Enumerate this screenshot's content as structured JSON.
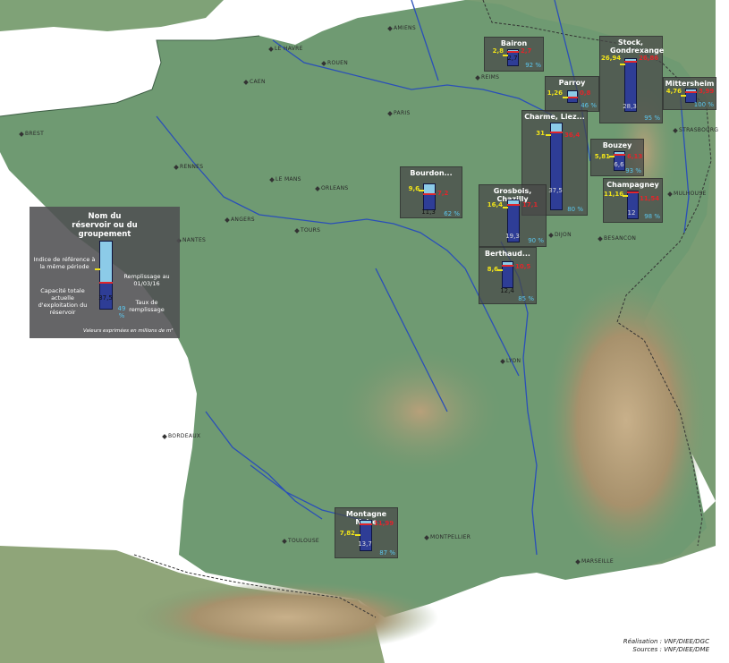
{
  "cities": [
    {
      "id": "amiens",
      "name": "AMIENS"
    },
    {
      "id": "le-havre",
      "name": "LE HAVRE"
    },
    {
      "id": "rouen",
      "name": "ROUEN"
    },
    {
      "id": "caen",
      "name": "CAEN"
    },
    {
      "id": "reims",
      "name": "REIMS"
    },
    {
      "id": "paris",
      "name": "PARIS"
    },
    {
      "id": "brest",
      "name": "BREST"
    },
    {
      "id": "rennes",
      "name": "RENNES"
    },
    {
      "id": "le-mans",
      "name": "LE MANS"
    },
    {
      "id": "orleans",
      "name": "ORLEANS"
    },
    {
      "id": "angers",
      "name": "ANGERS"
    },
    {
      "id": "tours",
      "name": "TOURS"
    },
    {
      "id": "nantes",
      "name": "NANTES"
    },
    {
      "id": "dijon",
      "name": "DIJON"
    },
    {
      "id": "besancon",
      "name": "BESANCON"
    },
    {
      "id": "mulhouse",
      "name": "MULHOUSE"
    },
    {
      "id": "strasbourg",
      "name": "STRASBOURG"
    },
    {
      "id": "lyon",
      "name": "LYON"
    },
    {
      "id": "bordeaux",
      "name": "BORDEAUX"
    },
    {
      "id": "toulouse",
      "name": "TOULOUSE"
    },
    {
      "id": "montpellier",
      "name": "MONTPELLIER"
    },
    {
      "id": "marseille",
      "name": "MARSEILLE"
    }
  ],
  "reservoirs": [
    {
      "id": "bairon",
      "name": "Bairon",
      "reference": "2,8",
      "filling": "2,7",
      "capacity": "2,7",
      "rate": "92 %",
      "ref_level": 0.3,
      "fill_level": 0.1
    },
    {
      "id": "parroy",
      "name": "Parroy",
      "reference": "1,26",
      "filling": "0,8",
      "capacity": "",
      "rate": "46 %",
      "ref_level": 0.5,
      "fill_level": 0.55
    },
    {
      "id": "stock",
      "name": "Stock, Gondrexange",
      "reference": "26,94",
      "filling": "26,86",
      "capacity": "28,3",
      "rate": "95 %",
      "ref_level": 0.08,
      "fill_level": 0.06
    },
    {
      "id": "mittersheim",
      "name": "Mittersheim",
      "reference": "4,76",
      "filling": "3,99",
      "capacity": "",
      "rate": "100 %",
      "ref_level": 0.4,
      "fill_level": 0.2
    },
    {
      "id": "charme",
      "name": "Charme, Liez...",
      "reference": "31",
      "filling": "36,4",
      "capacity": "37,5",
      "rate": "80 %",
      "ref_level": 0.12,
      "fill_level": 0.1
    },
    {
      "id": "bouzey",
      "name": "Bouzey",
      "reference": "5,81",
      "filling": "6,13",
      "capacity": "6,6",
      "rate": "93 %",
      "ref_level": 0.2,
      "fill_level": 0.15
    },
    {
      "id": "bourdon",
      "name": "Bourdon...",
      "reference": "9,6",
      "filling": "7,2",
      "capacity": "11,3",
      "rate": "62 %",
      "ref_level": 0.2,
      "fill_level": 0.38
    },
    {
      "id": "grosbois",
      "name": "Grosbois, Chazilly",
      "reference": "16,4",
      "filling": "17,1",
      "capacity": "19,3",
      "rate": "90 %",
      "ref_level": 0.15,
      "fill_level": 0.1
    },
    {
      "id": "champagney",
      "name": "Champagney",
      "reference": "11,16",
      "filling": "11,54",
      "capacity": "12",
      "rate": "98 %",
      "ref_level": 0.12,
      "fill_level": 0.04
    },
    {
      "id": "berthaud",
      "name": "Berthaud...",
      "reference": "8,6",
      "filling": "10,5",
      "capacity": "12,4",
      "rate": "85 %",
      "ref_level": 0.3,
      "fill_level": 0.15
    },
    {
      "id": "montagne-noire",
      "name": "Montagne Noire",
      "reference": "7,82",
      "filling": "11,99",
      "capacity": "13,7",
      "rate": "87 %",
      "ref_level": 0.45,
      "fill_level": 0.13
    }
  ],
  "legend": {
    "title": "Nom du réservoir ou du groupement",
    "reference_label": "Indice de référence à la même période",
    "filling_label": "Remplissage au 01/03/16",
    "capacity_label": "Capacité totale actuelle d'exploitation du réservoir",
    "rate_label": "Taux de remplissage",
    "capacity_value": "37,5",
    "rate_value": "49 %",
    "unit_note": "Valeurs exprimées en millions de m³"
  },
  "credits": {
    "line1": "Réalisation : VNF/DIEE/DGC",
    "line2": "Sources : VNF/DIEE/DME"
  },
  "colors": {
    "sea": "#ffffff",
    "land": "#6f9a72",
    "mountains": "#b39872",
    "river": "#2a4fb8",
    "gauge_fill": "#2e3d96",
    "gauge_empty": "#8ccbe8",
    "filling_value": "#e0262b",
    "reference_value": "#f0e31a",
    "rate_value": "#5bc6ee"
  }
}
